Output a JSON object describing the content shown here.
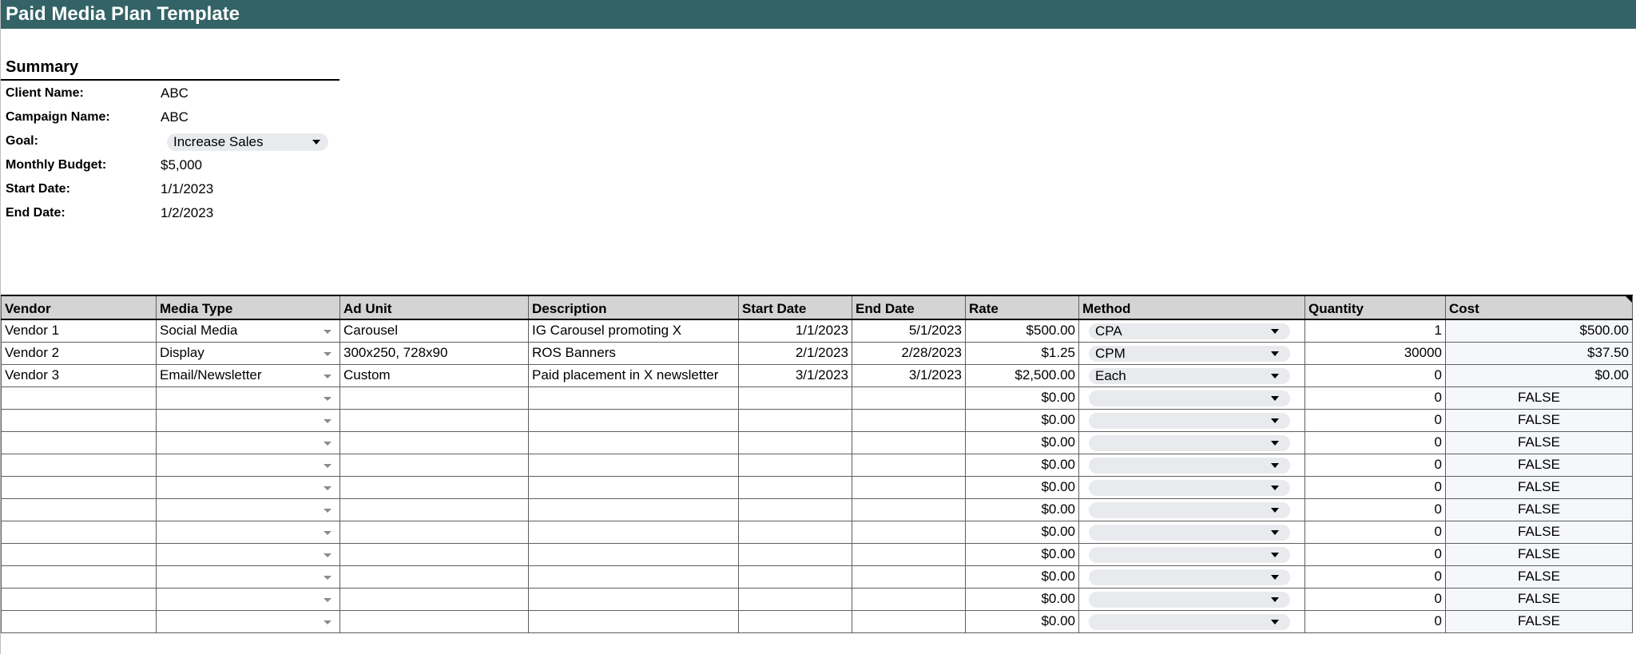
{
  "header": {
    "title": "Paid Media Plan Template"
  },
  "summary": {
    "title": "Summary",
    "fields": [
      {
        "label": "Client Name:",
        "value": "ABC",
        "type": "text"
      },
      {
        "label": "Campaign Name:",
        "value": "ABC",
        "type": "text"
      },
      {
        "label": "Goal:",
        "value": "Increase Sales",
        "type": "dropdown"
      },
      {
        "label": "Monthly Budget:",
        "value": "$5,000",
        "type": "text"
      },
      {
        "label": "Start Date:",
        "value": "1/1/2023",
        "type": "text"
      },
      {
        "label": "End Date:",
        "value": "1/2/2023",
        "type": "text"
      }
    ]
  },
  "table": {
    "columns": [
      "Vendor",
      "Media Type",
      "Ad Unit",
      "Description",
      "Start Date",
      "End Date",
      "Rate",
      "Method",
      "Quantity",
      "Cost"
    ],
    "rows": [
      {
        "vendor": "Vendor 1",
        "media_type": "Social Media",
        "ad_unit": "Carousel",
        "description": "IG Carousel promoting X",
        "start": "1/1/2023",
        "end": "5/1/2023",
        "rate": "$500.00",
        "method": "CPA",
        "quantity": "1",
        "cost": "$500.00"
      },
      {
        "vendor": "Vendor 2",
        "media_type": "Display",
        "ad_unit": "300x250, 728x90",
        "description": "ROS Banners",
        "start": "2/1/2023",
        "end": "2/28/2023",
        "rate": "$1.25",
        "method": "CPM",
        "quantity": "30000",
        "cost": "$37.50"
      },
      {
        "vendor": "Vendor 3",
        "media_type": "Email/Newsletter",
        "ad_unit": "Custom",
        "description": "Paid placement in X newsletter",
        "start": "3/1/2023",
        "end": "3/1/2023",
        "rate": "$2,500.00",
        "method": "Each",
        "quantity": "0",
        "cost": "$0.00"
      },
      {
        "vendor": "",
        "media_type": "",
        "ad_unit": "",
        "description": "",
        "start": "",
        "end": "",
        "rate": "$0.00",
        "method": "",
        "quantity": "0",
        "cost": "FALSE"
      },
      {
        "vendor": "",
        "media_type": "",
        "ad_unit": "",
        "description": "",
        "start": "",
        "end": "",
        "rate": "$0.00",
        "method": "",
        "quantity": "0",
        "cost": "FALSE"
      },
      {
        "vendor": "",
        "media_type": "",
        "ad_unit": "",
        "description": "",
        "start": "",
        "end": "",
        "rate": "$0.00",
        "method": "",
        "quantity": "0",
        "cost": "FALSE"
      },
      {
        "vendor": "",
        "media_type": "",
        "ad_unit": "",
        "description": "",
        "start": "",
        "end": "",
        "rate": "$0.00",
        "method": "",
        "quantity": "0",
        "cost": "FALSE"
      },
      {
        "vendor": "",
        "media_type": "",
        "ad_unit": "",
        "description": "",
        "start": "",
        "end": "",
        "rate": "$0.00",
        "method": "",
        "quantity": "0",
        "cost": "FALSE"
      },
      {
        "vendor": "",
        "media_type": "",
        "ad_unit": "",
        "description": "",
        "start": "",
        "end": "",
        "rate": "$0.00",
        "method": "",
        "quantity": "0",
        "cost": "FALSE"
      },
      {
        "vendor": "",
        "media_type": "",
        "ad_unit": "",
        "description": "",
        "start": "",
        "end": "",
        "rate": "$0.00",
        "method": "",
        "quantity": "0",
        "cost": "FALSE"
      },
      {
        "vendor": "",
        "media_type": "",
        "ad_unit": "",
        "description": "",
        "start": "",
        "end": "",
        "rate": "$0.00",
        "method": "",
        "quantity": "0",
        "cost": "FALSE"
      },
      {
        "vendor": "",
        "media_type": "",
        "ad_unit": "",
        "description": "",
        "start": "",
        "end": "",
        "rate": "$0.00",
        "method": "",
        "quantity": "0",
        "cost": "FALSE"
      },
      {
        "vendor": "",
        "media_type": "",
        "ad_unit": "",
        "description": "",
        "start": "",
        "end": "",
        "rate": "$0.00",
        "method": "",
        "quantity": "0",
        "cost": "FALSE"
      },
      {
        "vendor": "",
        "media_type": "",
        "ad_unit": "",
        "description": "",
        "start": "",
        "end": "",
        "rate": "$0.00",
        "method": "",
        "quantity": "0",
        "cost": "FALSE"
      }
    ]
  },
  "colors": {
    "title_bar": "#336366",
    "header_fill": "#d4d4d4",
    "chip_fill": "#e8eaed"
  },
  "icons": {
    "dropdown": "chevron-down-icon"
  }
}
